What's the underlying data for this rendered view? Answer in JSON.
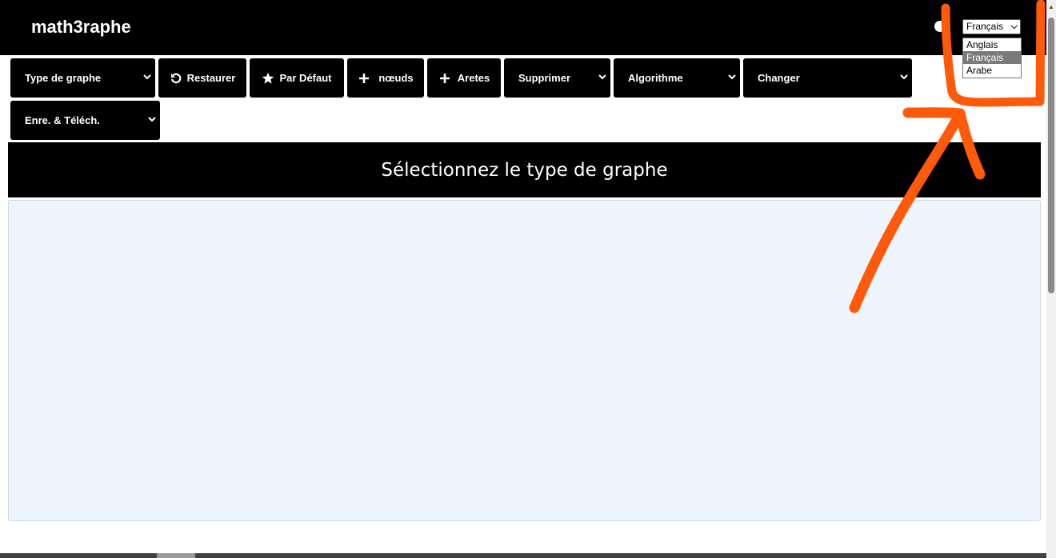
{
  "header": {
    "brand": "math3raphe",
    "language": {
      "selected": "Français",
      "options": [
        "Anglais",
        "Français",
        "Arabe"
      ]
    }
  },
  "toolbar": {
    "graph_type": "Type de graphe",
    "restore": "Restaurer",
    "default": "Par Défaut",
    "nodes": "nœuds",
    "edges": "Aretes",
    "delete": "Supprimer",
    "algorithm": "Algorithme",
    "change": "Changer",
    "save_download": "Enre. & Téléch."
  },
  "main": {
    "title": "Sélectionnez le type de graphe"
  },
  "colors": {
    "header_bg": "#000000",
    "canvas_bg": "#eef5fd",
    "annotation": "#ff5a0a"
  },
  "icons": {
    "restore": "rotate-left-icon",
    "default": "star-icon",
    "add": "plus-icon",
    "dropdown": "chevron-down-icon"
  }
}
